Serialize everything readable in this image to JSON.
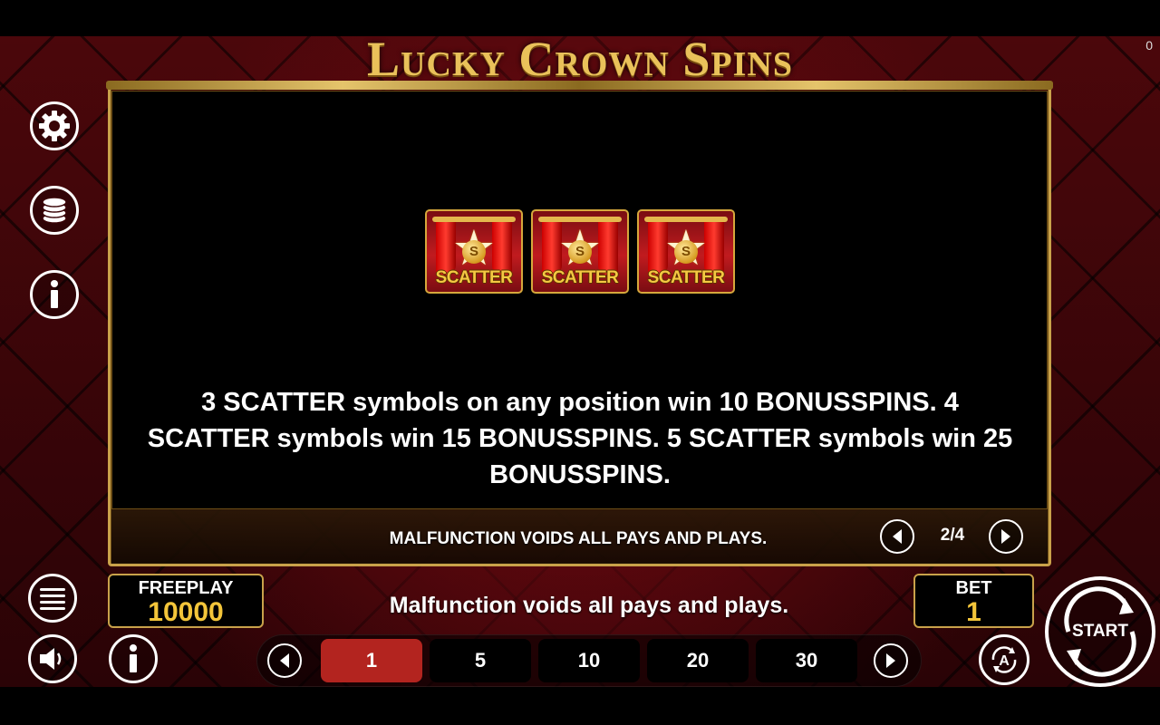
{
  "game": {
    "title": "Lucky Crown Spins",
    "corner_counter": "0"
  },
  "info_page": {
    "symbols": [
      {
        "label": "SCATTER",
        "coin_mark": "S",
        "icon": "scatter-symbol-icon"
      },
      {
        "label": "SCATTER",
        "coin_mark": "S",
        "icon": "scatter-symbol-icon"
      },
      {
        "label": "SCATTER",
        "coin_mark": "S",
        "icon": "scatter-symbol-icon"
      }
    ],
    "rule_text": "3 SCATTER symbols on any position win 10 BONUSSPINS. 4 SCATTER symbols win 15 BONUSSPINS. 5 SCATTER symbols win 25 BONUSSPINS.",
    "footer_notice": "MALFUNCTION VOIDS ALL PAYS AND PLAYS.",
    "pager": {
      "current": 2,
      "total": 4,
      "text": "2/4"
    }
  },
  "left_controls": {
    "settings_icon": "gear-icon",
    "coins_icon": "coin-stack-icon",
    "info_icon": "info-icon",
    "menu_icon": "hamburger-menu-icon",
    "sound_icon": "speaker-icon",
    "paytable_icon": "info-icon"
  },
  "freeplay": {
    "label": "FREEPLAY",
    "value": "10000"
  },
  "bet": {
    "label": "BET",
    "value": "1"
  },
  "status_message": "Malfunction voids all pays and plays.",
  "bet_selector": {
    "options": [
      "1",
      "5",
      "10",
      "20",
      "30"
    ],
    "selected": "1"
  },
  "autoplay_icon": "autoplay-icon",
  "start": {
    "label": "START"
  },
  "colors": {
    "gold": "#c9a24a",
    "value_yellow": "#f3c53a",
    "selected_red": "#b3241f",
    "background_red": "#3a0508"
  }
}
